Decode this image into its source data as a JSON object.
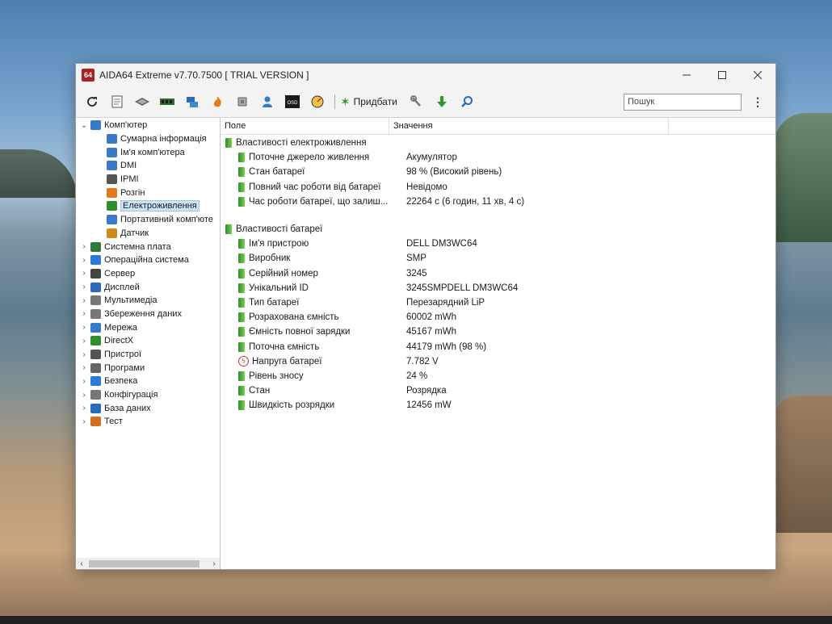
{
  "window": {
    "app_icon": "64",
    "title": "AIDA64 Extreme v7.70.7500  [ TRIAL VERSION ]",
    "minimize_icon": "minimize-icon",
    "maximize_icon": "maximize-icon",
    "close_icon": "close-icon"
  },
  "toolbar": {
    "icons": [
      "refresh-icon",
      "report-icon",
      "motherboard-icon",
      "memory-icon",
      "network-icon",
      "flame-icon",
      "cpu-icon",
      "user-icon",
      "osd-icon",
      "gauge-icon"
    ],
    "osd_label": "OSD",
    "add_label": "Придбати",
    "search_placeholder": "Пошук"
  },
  "tree": {
    "root": {
      "label": "Комп'ютер",
      "expanded": true
    },
    "children": [
      {
        "label": "Сумарна інформація",
        "icon": "computer-icon",
        "color": "#3a78c8"
      },
      {
        "label": "Ім'я комп'ютера",
        "icon": "computer-icon",
        "color": "#3a78c8"
      },
      {
        "label": "DMI",
        "icon": "dmi-icon",
        "color": "#3a78c8"
      },
      {
        "label": "IPMI",
        "icon": "ipmi-icon",
        "color": "#555555"
      },
      {
        "label": "Розгін",
        "icon": "flame-icon",
        "color": "#e07a1a"
      },
      {
        "label": "Електроживлення",
        "icon": "battery-icon",
        "color": "#2f8f2f",
        "selected": true
      },
      {
        "label": "Портативний комп'юте",
        "icon": "laptop-icon",
        "color": "#3a78c8"
      },
      {
        "label": "Датчик",
        "icon": "sensor-icon",
        "color": "#d08a1a"
      }
    ],
    "groups": [
      {
        "label": "Системна плата",
        "icon": "motherboard-icon",
        "color": "#2f7a3a"
      },
      {
        "label": "Операційна система",
        "icon": "windows-icon",
        "color": "#2a7ad8"
      },
      {
        "label": "Сервер",
        "icon": "server-icon",
        "color": "#444444"
      },
      {
        "label": "Дисплей",
        "icon": "display-icon",
        "color": "#2a6ab8"
      },
      {
        "label": "Мультимедіа",
        "icon": "speaker-icon",
        "color": "#777777"
      },
      {
        "label": "Збереження даних",
        "icon": "storage-icon",
        "color": "#777777"
      },
      {
        "label": "Мережа",
        "icon": "network-icon",
        "color": "#3a78c8"
      },
      {
        "label": "DirectX",
        "icon": "xbox-icon",
        "color": "#2f8f2f"
      },
      {
        "label": "Пристрої",
        "icon": "devices-icon",
        "color": "#555555"
      },
      {
        "label": "Програми",
        "icon": "programs-icon",
        "color": "#666666"
      },
      {
        "label": "Безпека",
        "icon": "shield-icon",
        "color": "#2a7ad8"
      },
      {
        "label": "Конфігурація",
        "icon": "config-icon",
        "color": "#777777"
      },
      {
        "label": "База даних",
        "icon": "database-icon",
        "color": "#2a6ab8"
      },
      {
        "label": "Тест",
        "icon": "benchmark-icon",
        "color": "#d07020"
      }
    ]
  },
  "list": {
    "columns": [
      "Поле",
      "Значення"
    ],
    "power_section": "Властивості електроживлення",
    "power_rows": [
      {
        "field": "Поточне джерело живлення",
        "value": "Акумулятор"
      },
      {
        "field": "Стан батареї",
        "value": "98 % (Високий рівень)"
      },
      {
        "field": "Повний час роботи від батареї",
        "value": "Невідомо"
      },
      {
        "field": "Час роботи батареї, що залиш...",
        "value": "22264 с (6 годин, 11 хв, 4 с)"
      }
    ],
    "battery_section": "Властивості батареї",
    "battery_rows": [
      {
        "field": "Ім'я пристрою",
        "value": "DELL DM3WC64"
      },
      {
        "field": "Виробник",
        "value": "SMP"
      },
      {
        "field": "Серійний номер",
        "value": "3245"
      },
      {
        "field": "Унікальний ID",
        "value": "3245SMPDELL DM3WC64"
      },
      {
        "field": "Тип батареї",
        "value": "Перезарядний LiP"
      },
      {
        "field": "Розрахована ємність",
        "value": "60002 mWh"
      },
      {
        "field": "Ємність повної зарядки",
        "value": "45167 mWh"
      },
      {
        "field": "Поточна ємність",
        "value": "44179 mWh  (98 %)"
      },
      {
        "field": "Напруга батареї",
        "value": "7.782 V",
        "icon": "voltage-icon"
      },
      {
        "field": "Рівень зносу",
        "value": "24 %"
      },
      {
        "field": "Стан",
        "value": "Розрядка"
      },
      {
        "field": "Швидкість розрядки",
        "value": "12456 mW"
      }
    ]
  }
}
